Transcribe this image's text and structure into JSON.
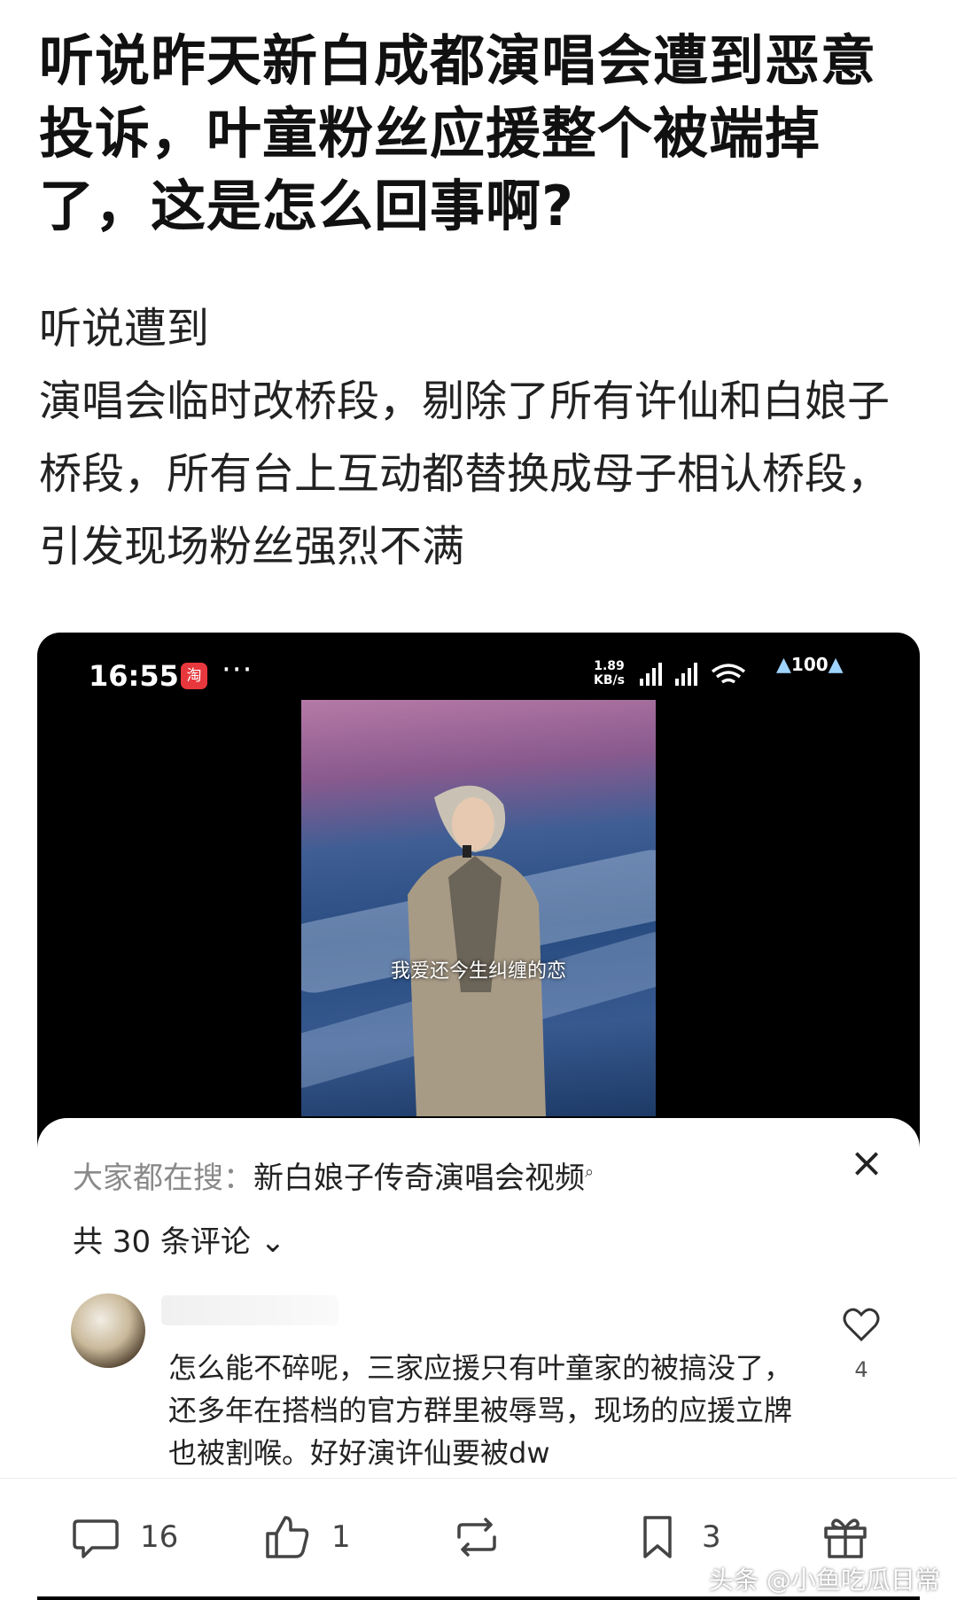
{
  "post": {
    "title": "听说昨天新白成都演唱会遭到恶意投诉，叶童粉丝应援整个被端掉了，这是怎么回事啊?",
    "body_line1": "听说遭到",
    "body_rest": "演唱会临时改桥段，剔除了所有许仙和白娘子桥段，所有台上互动都替换成母子相认桥段，引发现场粉丝强烈不满"
  },
  "screenshot": {
    "status_bar": {
      "time": "16:55",
      "app_badge": "淘",
      "more": "···",
      "net_speed_value": "1.89",
      "net_speed_unit": "KB/s",
      "battery": "100"
    },
    "video": {
      "caption": "我爱还今生纠缠的恋"
    },
    "comments_sheet": {
      "hot_search_label": "大家都在搜：",
      "hot_search_query": "新白娘子传奇演唱会视频",
      "comment_count": "共 30 条评论 ⌄",
      "comment_text": "怎么能不碎呢，三家应援只有叶童家的被搞没了，还多年在搭档的官方群里被辱骂，现场的应援立牌也被割喉。好好演许仙要被dw",
      "like_count": "4"
    }
  },
  "action_bar": {
    "comments": "16",
    "likes": "1",
    "favorites": "3"
  },
  "watermark": "头条 @小鱼吃瓜日常"
}
